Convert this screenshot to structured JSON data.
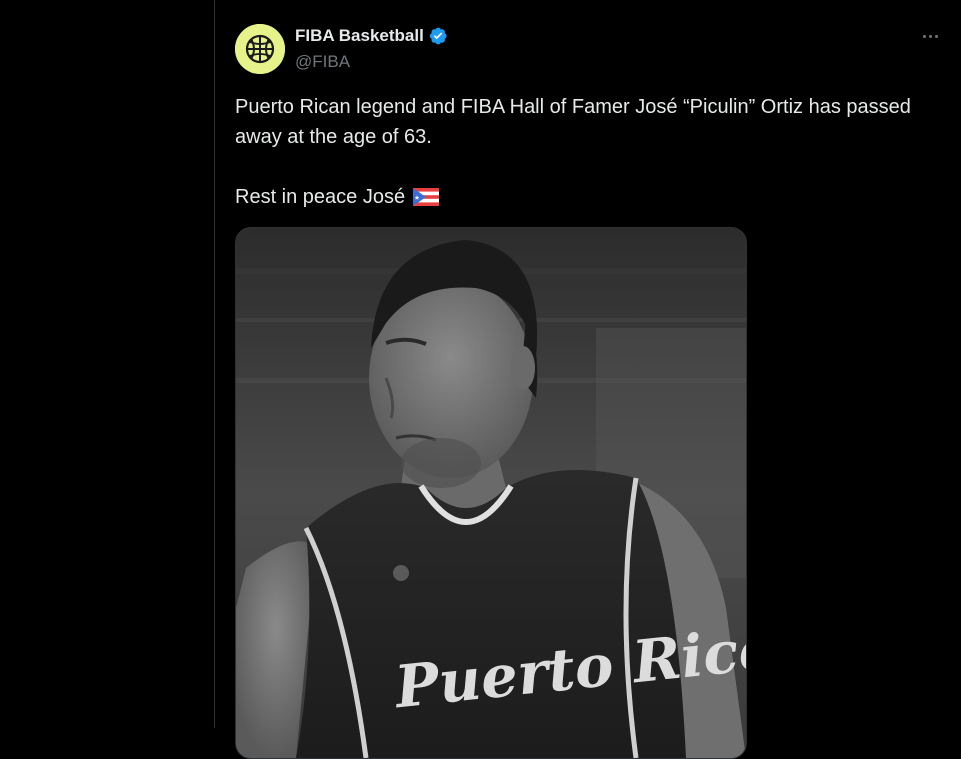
{
  "author": {
    "display_name": "FIBA Basketball",
    "handle": "@FIBA",
    "verified": true,
    "avatar_color": "#e6f28a"
  },
  "tweet": {
    "line1": "Puerto Rican legend and FIBA Hall of Famer José “Piculin” Ortiz has passed away at the age of 63.",
    "line2": "Rest in peace José",
    "flag_icon": "puerto-rico-flag-icon"
  },
  "media": {
    "photo_icon": "player-photo",
    "jersey_text": "Puerto Rico"
  },
  "colors": {
    "background": "#000000",
    "text_primary": "#e7e9ea",
    "text_secondary": "#71767b",
    "verified_blue": "#1d9bf0",
    "border": "#2f3336"
  }
}
